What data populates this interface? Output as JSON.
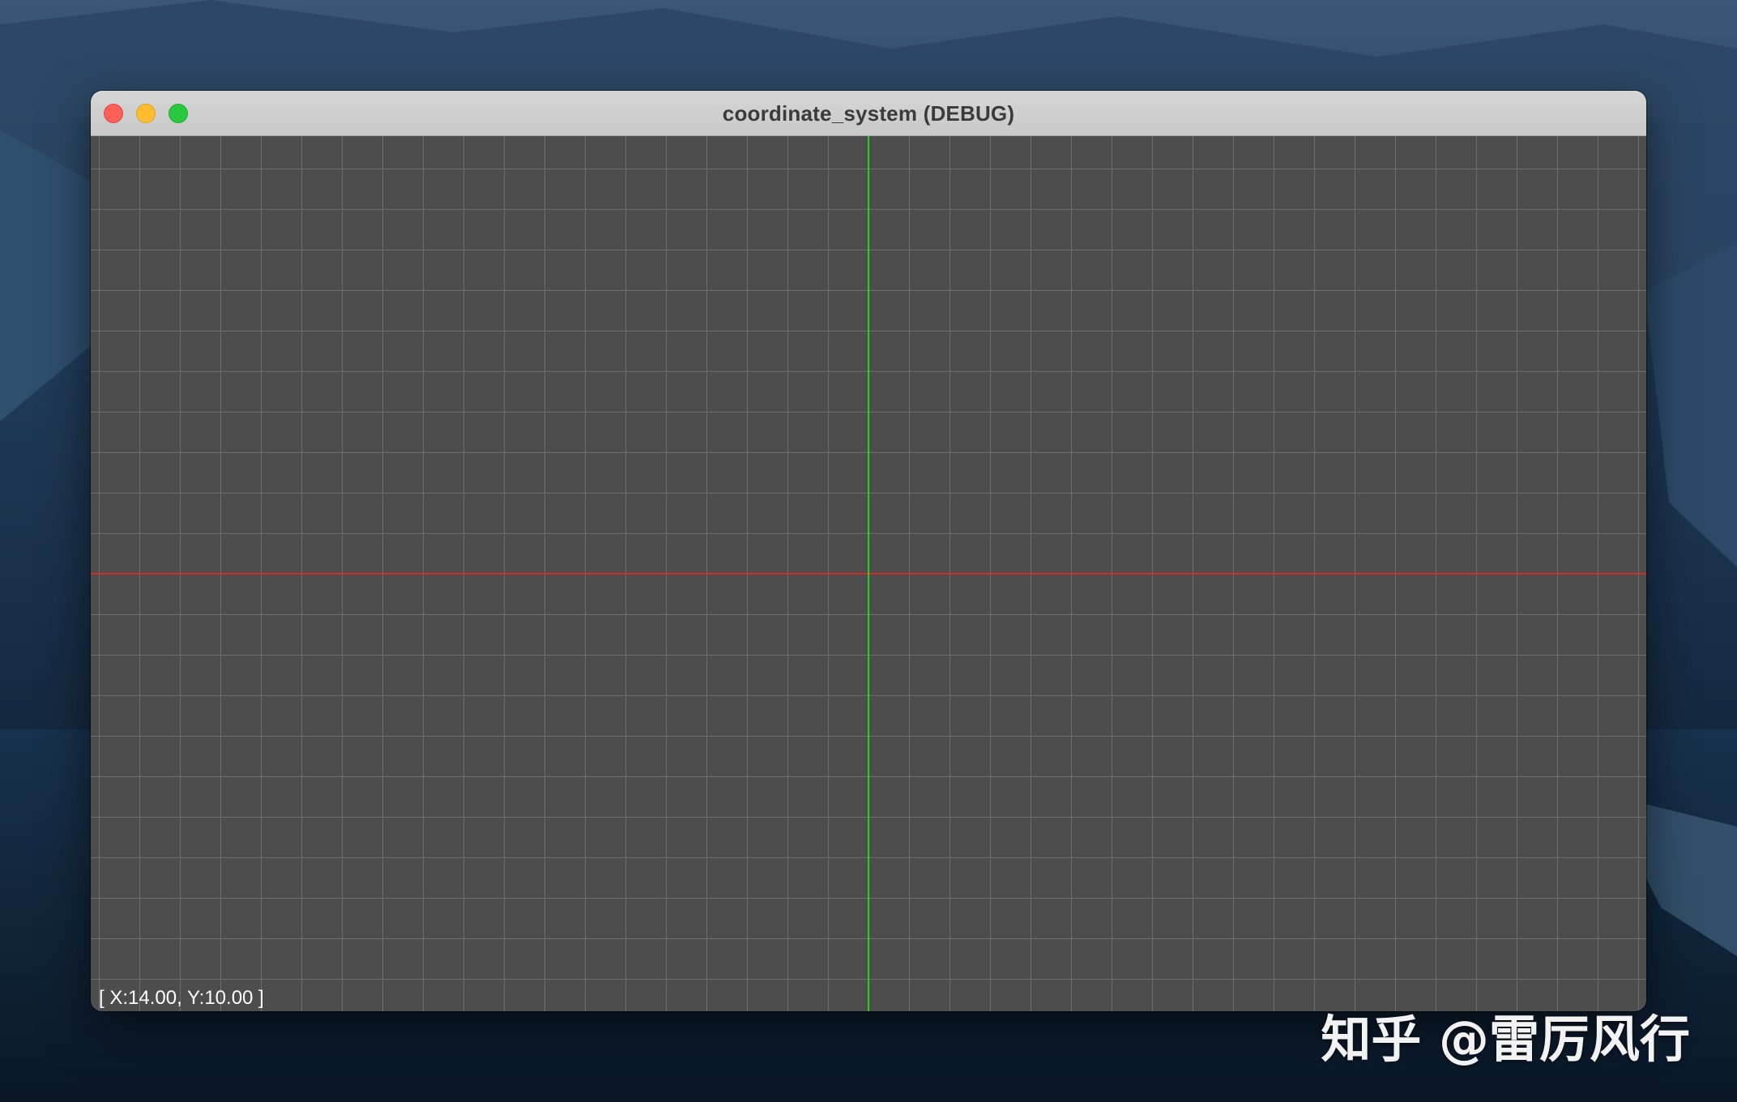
{
  "window": {
    "title": "coordinate_system (DEBUG)"
  },
  "titlebar_buttons": {
    "close_color": "#fe5f57",
    "minimize_color": "#febc2e",
    "maximize_color": "#28c840"
  },
  "canvas": {
    "background_color": "#4d4d4d",
    "grid_line_color": "#6e6e6e",
    "x_axis_color": "#d42a2a",
    "y_axis_color": "#22d422"
  },
  "status": {
    "cursor_readout": "[ X:14.00, Y:10.00 ]"
  },
  "watermark": {
    "text": "知乎 @雷厉风行"
  }
}
